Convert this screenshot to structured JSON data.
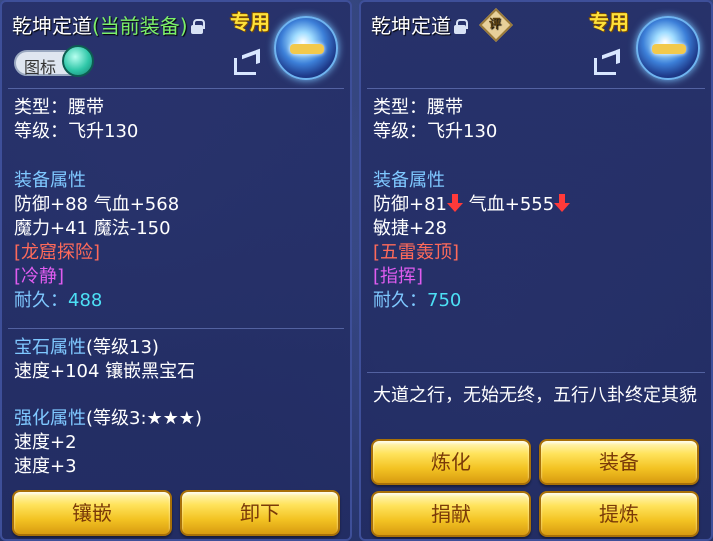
{
  "left": {
    "title": "乾坤定道",
    "title_current": "(当前装备)",
    "special": "专用",
    "toggle_label": "图标",
    "type": "类型：腰带",
    "level": "等级：飞升130",
    "equip_attr_header": "装备属性",
    "attr_line1": "防御+88 气血+568",
    "attr_line2": "魔力+41 魔法-150",
    "special_skill": "[龙窟探险]",
    "special_effect": "[冷静]",
    "durability_label": "耐久：",
    "durability_value": "488",
    "gem_header": "宝石属性",
    "gem_level": "(等级13)",
    "gem_line": "速度+104 镶嵌黑宝石",
    "enhance_header": "强化属性",
    "enhance_level": "(等级3:★★★)",
    "enhance_line1": "速度+2",
    "enhance_line2": "速度+3",
    "buttons": {
      "inlay": "镶嵌",
      "unequip": "卸下"
    }
  },
  "right": {
    "title": "乾坤定道",
    "rate_badge": "评",
    "special": "专用",
    "type": "类型：腰带",
    "level": "等级：飞升130",
    "equip_attr_header": "装备属性",
    "attr_def": "防御+81",
    "attr_hp": "气血+555",
    "attr_line2": "敏捷+28",
    "special_skill": "[五雷轰顶]",
    "special_effect": "[指挥]",
    "durability_label": "耐久：",
    "durability_value": "750",
    "description": "大道之行，无始无终，五行八卦终定其貌",
    "buttons": {
      "refine": "炼化",
      "equip": "装备",
      "donate": "捐献",
      "extract": "提炼"
    }
  },
  "colors": {
    "section": "#7fc8ff",
    "special_skill": "#ff6a5a",
    "special_effect": "#e05cf0",
    "durability": "#4de0f5",
    "current_equip": "#7cf06a",
    "button": "#f3c323",
    "down_arrow": "#ff3a3a"
  },
  "icons": [
    "lock-icon",
    "rate-badge-icon",
    "share-icon",
    "item-belt-icon",
    "down-arrow-icon"
  ]
}
